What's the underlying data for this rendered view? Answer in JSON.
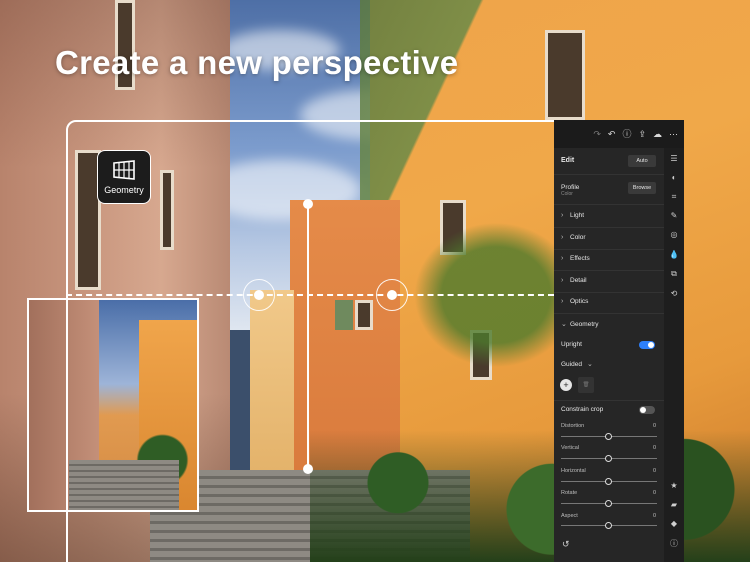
{
  "headline": "Create a new perspective",
  "badge": {
    "label": "Geometry",
    "icon": "geometry-grid-icon"
  },
  "toolbar": {
    "icons": [
      "redo-icon",
      "undo-icon",
      "help-icon",
      "share-icon",
      "cloud-icon",
      "more-icon"
    ]
  },
  "panel": {
    "title": "Edit",
    "auto_label": "Auto",
    "profile": {
      "label": "Profile",
      "value": "Color",
      "browse_label": "Browse"
    },
    "sections": [
      "Light",
      "Color",
      "Effects",
      "Detail",
      "Optics"
    ],
    "geometry": {
      "label": "Geometry",
      "upright": {
        "label": "Upright",
        "enabled": true
      },
      "mode": "Guided",
      "constrain_crop": {
        "label": "Constrain crop",
        "enabled": false
      },
      "sliders": [
        {
          "label": "Distortion",
          "value": "0"
        },
        {
          "label": "Vertical",
          "value": "0"
        },
        {
          "label": "Horizontal",
          "value": "0"
        },
        {
          "label": "Rotate",
          "value": "0"
        },
        {
          "label": "Aspect",
          "value": "0"
        }
      ]
    },
    "accent_color": "#2d7ff9"
  },
  "rail_icons": [
    "sliders-icon",
    "circle-half-icon",
    "crop-icon",
    "brush-icon",
    "radial-icon",
    "heal-icon",
    "versions-icon",
    "history-icon",
    "star-icon",
    "comment-icon",
    "tag-icon",
    "info-icon"
  ]
}
